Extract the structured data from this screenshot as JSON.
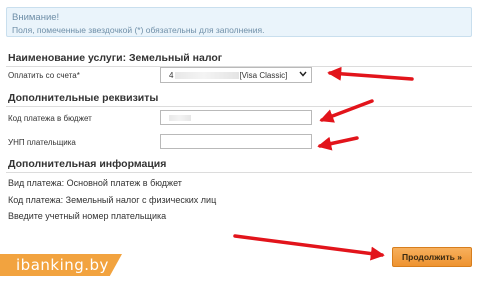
{
  "notice": {
    "title": "Внимание!",
    "text": "Поля, помеченные звездочкой (*) обязательны для заполнения."
  },
  "service_section": {
    "title": "Наименование услуги: Земельный налог",
    "pay_from_label": "Оплатить со счета*",
    "account_prefix": "4",
    "account_suffix": "[Visa Classic]"
  },
  "details_section": {
    "title": "Дополнительные реквизиты",
    "budget_code_label": "Код платежа в бюджет",
    "unp_label": "УНП плательщика",
    "unp_value": ""
  },
  "info_section": {
    "title": "Дополнительная информация",
    "lines": [
      "Вид платежа: Основной платеж в бюджет",
      "Код платежа: Земельный налог с физических лиц",
      "Введите учетный номер плательщика"
    ]
  },
  "continue_label": "Продолжить »",
  "watermark": "ibanking.by",
  "colors": {
    "accent_orange": "#ee9330",
    "arrow_red": "#e2141b",
    "notice_bg": "#eaf4fb"
  },
  "icons": {
    "select_chevron": "chevron-down-icon"
  }
}
